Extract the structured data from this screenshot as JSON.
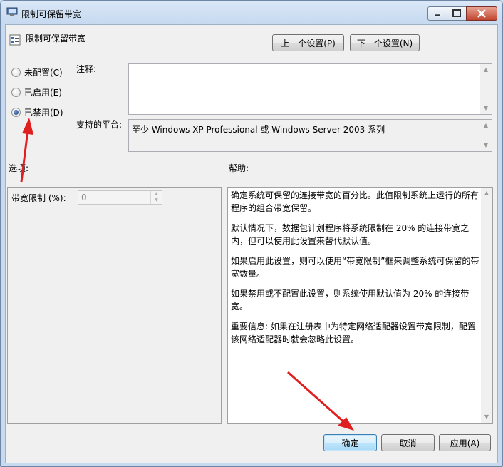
{
  "window": {
    "title": "限制可保留带宽"
  },
  "header": {
    "setting_name": "限制可保留带宽",
    "prev_button": "上一个设置(P)",
    "next_button": "下一个设置(N)"
  },
  "state": {
    "not_configured": "未配置(C)",
    "enabled": "已启用(E)",
    "disabled": "已禁用(D)",
    "selected": "disabled"
  },
  "comment": {
    "label": "注释:",
    "value": ""
  },
  "platform": {
    "label": "支持的平台:",
    "value": "至少 Windows XP Professional 或 Windows Server 2003 系列"
  },
  "options": {
    "label": "选项:",
    "bandwidth_label": "带宽限制 (%):",
    "bandwidth_value": "0"
  },
  "help": {
    "label": "帮助:",
    "paragraphs": [
      "确定系统可保留的连接带宽的百分比。此值限制系统上运行的所有程序的组合带宽保留。",
      "默认情况下，数据包计划程序将系统限制在 20% 的连接带宽之内，但可以使用此设置来替代默认值。",
      "如果启用此设置，则可以使用“带宽限制”框来调整系统可保留的带宽数量。",
      "如果禁用或不配置此设置，则系统使用默认值为 20% 的连接带宽。",
      "重要信息: 如果在注册表中为特定网络适配器设置带宽限制，配置该网络适配器时就会忽略此设置。"
    ]
  },
  "footer": {
    "ok": "确定",
    "cancel": "取消",
    "apply": "应用(A)"
  },
  "colors": {
    "annotation_arrow": "#e02020"
  }
}
